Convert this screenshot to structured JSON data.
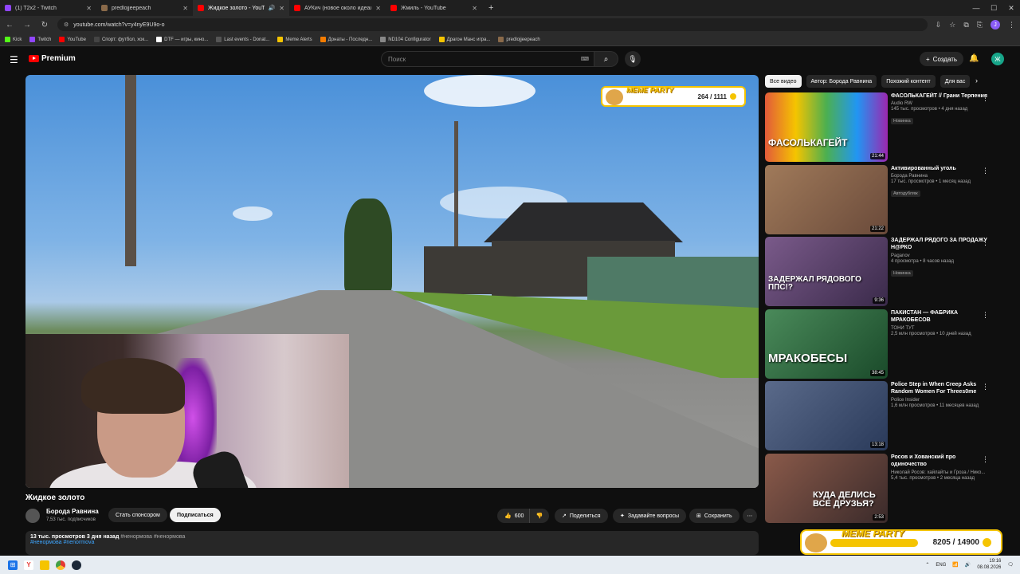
{
  "browser": {
    "tabs": [
      {
        "title": "(1) T2x2 - Twitch",
        "favicon_color": "#9146ff",
        "active": false
      },
      {
        "title": "predlojjeepeach",
        "favicon_color": "#8a6a4a",
        "active": false
      },
      {
        "title": "Жидкое золото - YouTube",
        "favicon_color": "#ff0000",
        "active": true
      },
      {
        "title": "АУКич (новое около идеальн",
        "favicon_color": "#ff0000",
        "active": false
      },
      {
        "title": "Жмиль - YouTube",
        "favicon_color": "#ff0000",
        "active": false
      }
    ],
    "url": "youtube.com/watch?v=y4nyE9U9o-o",
    "bookmarks": [
      {
        "label": "Kick",
        "color": "#53fc18"
      },
      {
        "label": "Twitch",
        "color": "#9146ff"
      },
      {
        "label": "YouTube",
        "color": "#ff0000"
      },
      {
        "label": "Спорт: футбол, хок...",
        "color": "#222222"
      },
      {
        "label": "DTF — игры, кино...",
        "color": "#ffffff"
      },
      {
        "label": "Last events - Donat...",
        "color": "#333333"
      },
      {
        "label": "Meme Alerts",
        "color": "#f5c400"
      },
      {
        "label": "Донаты - Последн...",
        "color": "#f57c00"
      },
      {
        "label": "ND104 Configurator",
        "color": "#888888"
      },
      {
        "label": "Драгон Манс игра...",
        "color": "#f5c400"
      },
      {
        "label": "predlojjeepeach",
        "color": "#8a6a4a"
      }
    ],
    "profile_letter": "J"
  },
  "yt": {
    "logo_text": "Premium",
    "search_placeholder": "Поиск",
    "create_label": "Создать",
    "avatar_letter": "Ж"
  },
  "video": {
    "title": "Жидкое золото",
    "channel": "Борода Равнина",
    "subscribers": "7,53 тыс. подписчиков",
    "sponsor_label": "Стать спонсором",
    "subscribe_label": "Подписаться",
    "likes": "600",
    "share_label": "Поделиться",
    "ask_label": "Задавайте вопросы",
    "save_label": "Сохранить",
    "views_line": "13 тыс. просмотров  3 дня назад",
    "tags_inline": "#ненормова #ненормова",
    "tags_link": "#ненормова #nenormova"
  },
  "meme_top": {
    "label": "MEME PARTY",
    "value": "264 / 1111"
  },
  "meme_bottom": {
    "label": "MEME PARTY",
    "value": "8205 / 14900"
  },
  "chips": [
    "Все видео",
    "Автор: Борода Равнина",
    "Похожий контент",
    "Для вас"
  ],
  "recommendations": [
    {
      "title": "ФАСОЛЬКАГЕЙТ // Грани Терпения",
      "channel": "Audio RW",
      "meta": "145 тыс. просмотров • 4 дня назад",
      "badge": "Новинка",
      "duration": "21:44",
      "thumb_text": "ФАСОЛЬКАГЕЙТ",
      "thumb_color": "#6aa0c8"
    },
    {
      "title": "Активированный уголь",
      "channel": "Борода Равнина",
      "meta": "17 тыс. просмотров • 1 месяц назад",
      "badge": "Автодубляж",
      "duration": "21:22",
      "thumb_text": "",
      "thumb_color": "#8a6a52"
    },
    {
      "title": "ЗАДЕРЖАЛ РЯДОГО ЗА ПРОДАЖУ Н@РКО",
      "channel": "Paganov",
      "meta": "4 просмотра • 8 часов назад",
      "badge": "Новинка",
      "duration": "9:36",
      "thumb_text": "ЗАДЕРЖАЛ РЯДОВОГО ППС!?",
      "thumb_color": "#5a4a6a"
    },
    {
      "title": "ПАКИСТАН — ФАБРИКА МРАКОБЕСОВ",
      "channel": "ТОНИ ТУТ",
      "meta": "2,5 млн просмотров • 10 дней назад",
      "badge": "",
      "duration": "38:45",
      "thumb_text": "МРАКОБЕСЫ",
      "thumb_color": "#3a7a4a"
    },
    {
      "title": "Police Step in When Creep Asks Random Women For Threes0me",
      "channel": "Police Insider",
      "meta": "1,6 млн просмотров • 11 месяцев назад",
      "badge": "",
      "duration": "13:18",
      "thumb_text": "",
      "thumb_color": "#4a5a7a"
    },
    {
      "title": "Росов и Хованский про одиночество",
      "channel": "Николай Росов: хайлайты и Гроза / Нико...",
      "meta": "5,4 тыс. просмотров • 2 месяца назад",
      "badge": "",
      "duration": "2:53",
      "thumb_text": "КУДА ДЕЛИСЬ ВСЕ ДРУЗЬЯ?",
      "thumb_color": "#6a4a3a"
    }
  ],
  "taskbar": {
    "lang": "ENG",
    "time": "19:16",
    "date": "08.08.2026"
  },
  "colors": {
    "accent": "#3ea6ff",
    "yt_red": "#ff0000",
    "meme_yellow": "#f5c400"
  }
}
